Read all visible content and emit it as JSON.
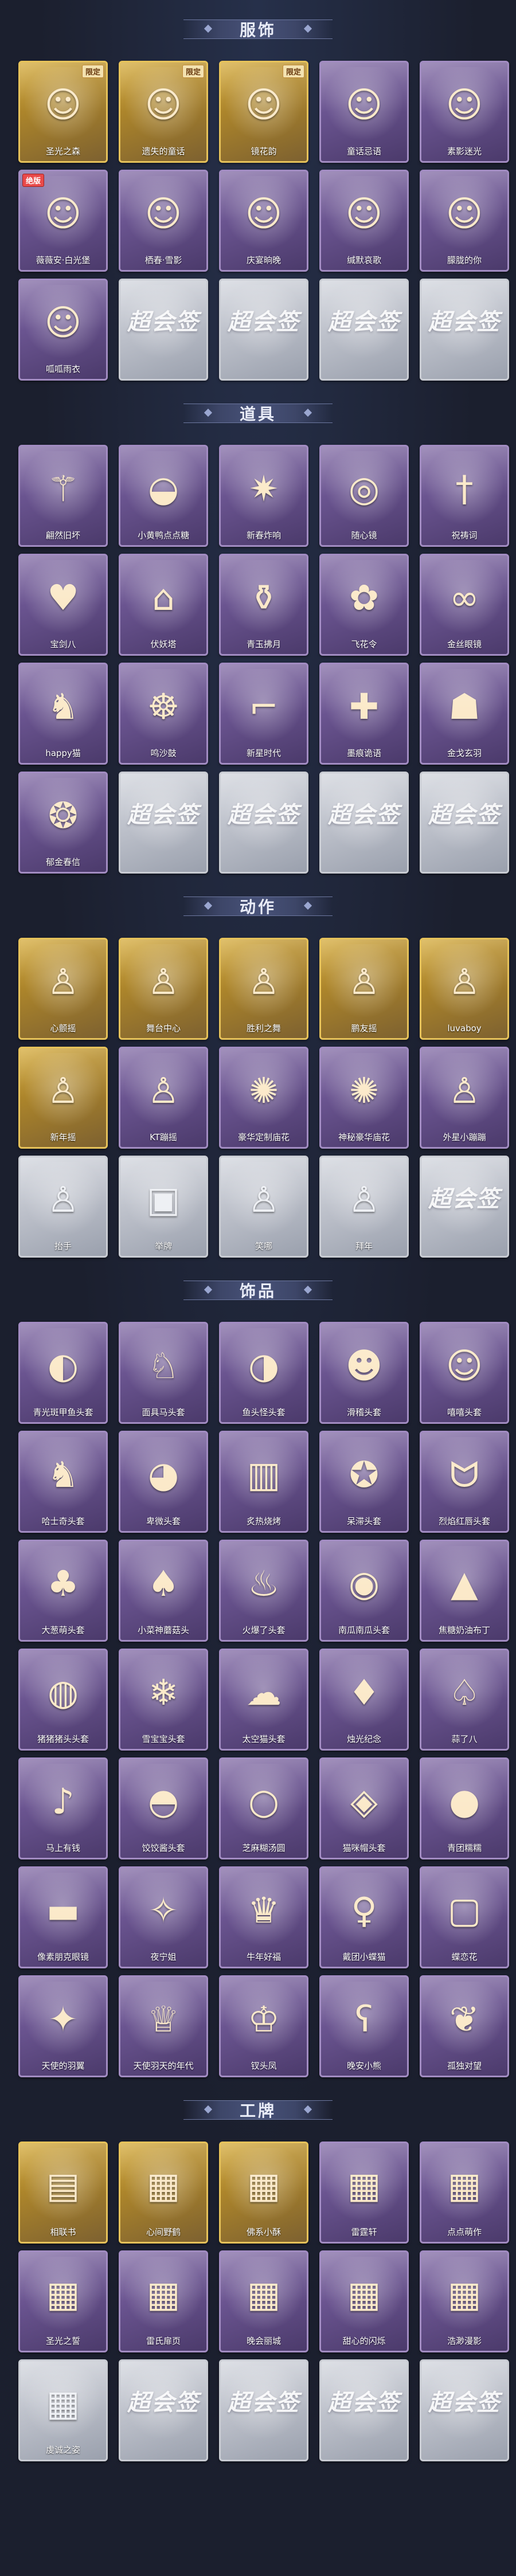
{
  "sections": [
    {
      "title": "服饰",
      "items": [
        {
          "label": "圣光之森",
          "rarity": "gold",
          "badge": "限定",
          "icon": "portrait-icon"
        },
        {
          "label": "遗失的童话",
          "rarity": "gold",
          "badge": "限定",
          "icon": "portrait-icon"
        },
        {
          "label": "镜花韵",
          "rarity": "gold",
          "badge": "限定",
          "icon": "portrait-icon"
        },
        {
          "label": "童话忌语",
          "rarity": "purple",
          "badge": "",
          "icon": "portrait-icon"
        },
        {
          "label": "素影迷光",
          "rarity": "purple",
          "badge": "",
          "icon": "portrait-icon"
        },
        {
          "label": "薇薇安·白光堡",
          "rarity": "purple",
          "badge": "绝版",
          "icon": "portrait-icon"
        },
        {
          "label": "栖春·雪影",
          "rarity": "purple",
          "badge": "",
          "icon": "portrait-icon"
        },
        {
          "label": "庆宴晌晚",
          "rarity": "purple",
          "badge": "",
          "icon": "portrait-icon"
        },
        {
          "label": "缄默哀歌",
          "rarity": "purple",
          "badge": "",
          "icon": "portrait-icon"
        },
        {
          "label": "朦胧的你",
          "rarity": "purple",
          "badge": "",
          "icon": "portrait-icon"
        },
        {
          "label": "呱呱雨衣",
          "rarity": "purple",
          "badge": "",
          "icon": "portrait-icon"
        },
        {
          "label": "",
          "rarity": "grey",
          "badge": "",
          "icon": "placeholder"
        },
        {
          "label": "",
          "rarity": "grey",
          "badge": "",
          "icon": "placeholder"
        },
        {
          "label": "",
          "rarity": "grey",
          "badge": "",
          "icon": "placeholder"
        },
        {
          "label": "",
          "rarity": "grey",
          "badge": "",
          "icon": "placeholder"
        }
      ]
    },
    {
      "title": "道具",
      "items": [
        {
          "label": "翩然旧坏",
          "rarity": "purple",
          "badge": "",
          "icon": "wand-icon"
        },
        {
          "label": "小黄鸭点点糖",
          "rarity": "purple",
          "badge": "",
          "icon": "duck-icon"
        },
        {
          "label": "新春炸响",
          "rarity": "purple",
          "badge": "",
          "icon": "firecracker-icon"
        },
        {
          "label": "随心镜",
          "rarity": "purple",
          "badge": "",
          "icon": "mirror-icon"
        },
        {
          "label": "祝祷词",
          "rarity": "purple",
          "badge": "",
          "icon": "sword-icon"
        },
        {
          "label": "宝剑八",
          "rarity": "purple",
          "badge": "",
          "icon": "heart-icon"
        },
        {
          "label": "伏妖塔",
          "rarity": "purple",
          "badge": "",
          "icon": "tower-icon"
        },
        {
          "label": "青玉拂月",
          "rarity": "purple",
          "badge": "",
          "icon": "bottle-icon"
        },
        {
          "label": "飞花令",
          "rarity": "purple",
          "badge": "",
          "icon": "flower-icon"
        },
        {
          "label": "金丝眼镜",
          "rarity": "purple",
          "badge": "",
          "icon": "glasses-icon"
        },
        {
          "label": "happy猫",
          "rarity": "purple",
          "badge": "",
          "icon": "cat-icon"
        },
        {
          "label": "鸣沙鼓",
          "rarity": "purple",
          "badge": "",
          "icon": "drum-icon"
        },
        {
          "label": "新星时代",
          "rarity": "purple",
          "badge": "",
          "icon": "gun-icon"
        },
        {
          "label": "墨痕诡语",
          "rarity": "purple",
          "badge": "",
          "icon": "medkit-icon"
        },
        {
          "label": "金戈玄羽",
          "rarity": "purple",
          "badge": "",
          "icon": "mask-icon"
        },
        {
          "label": "郁金春信",
          "rarity": "purple",
          "badge": "",
          "icon": "fan-icon"
        },
        {
          "label": "",
          "rarity": "grey",
          "badge": "",
          "icon": "placeholder"
        },
        {
          "label": "",
          "rarity": "grey",
          "badge": "",
          "icon": "placeholder"
        },
        {
          "label": "",
          "rarity": "grey",
          "badge": "",
          "icon": "placeholder"
        },
        {
          "label": "",
          "rarity": "grey",
          "badge": "",
          "icon": "placeholder"
        }
      ]
    },
    {
      "title": "动作",
      "items": [
        {
          "label": "心颤摇",
          "rarity": "gold",
          "badge": "",
          "icon": "pose-icon"
        },
        {
          "label": "舞台中心",
          "rarity": "gold",
          "badge": "",
          "icon": "pose-icon"
        },
        {
          "label": "胜利之舞",
          "rarity": "gold",
          "badge": "",
          "icon": "pose-icon"
        },
        {
          "label": "鹏友摇",
          "rarity": "gold",
          "badge": "",
          "icon": "pose-icon"
        },
        {
          "label": "luvaboy",
          "rarity": "gold",
          "badge": "",
          "icon": "pose-icon"
        },
        {
          "label": "新年摇",
          "rarity": "gold",
          "badge": "",
          "icon": "pose-icon"
        },
        {
          "label": "KT蹦摇",
          "rarity": "purple",
          "badge": "",
          "icon": "pose-icon"
        },
        {
          "label": "豪华定制庙花",
          "rarity": "purple",
          "badge": "",
          "icon": "firework-icon"
        },
        {
          "label": "神秘豪华庙花",
          "rarity": "purple",
          "badge": "",
          "icon": "firework-icon"
        },
        {
          "label": "外星小蹦蹦",
          "rarity": "purple",
          "badge": "",
          "icon": "pose-icon"
        },
        {
          "label": "抬手",
          "rarity": "grey",
          "badge": "",
          "icon": "pose-icon"
        },
        {
          "label": "举牌",
          "rarity": "grey",
          "badge": "",
          "icon": "sign-icon"
        },
        {
          "label": "笑哪",
          "rarity": "grey",
          "badge": "",
          "icon": "pose-icon"
        },
        {
          "label": "拜年",
          "rarity": "grey",
          "badge": "",
          "icon": "pose-icon"
        },
        {
          "label": "",
          "rarity": "grey",
          "badge": "",
          "icon": "placeholder"
        }
      ]
    },
    {
      "title": "饰品",
      "items": [
        {
          "label": "青光斑甲鱼头套",
          "rarity": "purple",
          "badge": "",
          "icon": "fish-icon"
        },
        {
          "label": "面具马头套",
          "rarity": "purple",
          "badge": "",
          "icon": "horse-icon"
        },
        {
          "label": "鱼头怪头套",
          "rarity": "purple",
          "badge": "",
          "icon": "fishhead-icon"
        },
        {
          "label": "滑稽头套",
          "rarity": "purple",
          "badge": "",
          "icon": "smile-icon"
        },
        {
          "label": "嘻嘻头套",
          "rarity": "purple",
          "badge": "",
          "icon": "grin-icon"
        },
        {
          "label": "哈士奇头套",
          "rarity": "purple",
          "badge": "",
          "icon": "dog-icon"
        },
        {
          "label": "卑微头套",
          "rarity": "purple",
          "badge": "",
          "icon": "sad-icon"
        },
        {
          "label": "炙热烧烤",
          "rarity": "purple",
          "badge": "",
          "icon": "toast-icon"
        },
        {
          "label": "呆滞头套",
          "rarity": "purple",
          "badge": "",
          "icon": "dizzy-icon"
        },
        {
          "label": "烈焰红唇头套",
          "rarity": "purple",
          "badge": "",
          "icon": "pikachu-icon"
        },
        {
          "label": "大葱萌头套",
          "rarity": "purple",
          "badge": "",
          "icon": "onion-icon"
        },
        {
          "label": "小菜神蘑菇头",
          "rarity": "purple",
          "badge": "",
          "icon": "mushroom-icon"
        },
        {
          "label": "火爆了头套",
          "rarity": "purple",
          "badge": "",
          "icon": "flame-icon"
        },
        {
          "label": "南瓜南瓜头套",
          "rarity": "purple",
          "badge": "",
          "icon": "pumpkin-icon"
        },
        {
          "label": "焦糖奶油布丁",
          "rarity": "purple",
          "badge": "",
          "icon": "pudding-icon"
        },
        {
          "label": "猪猪猪头头套",
          "rarity": "purple",
          "badge": "",
          "icon": "pig-icon"
        },
        {
          "label": "雪宝宝头套",
          "rarity": "purple",
          "badge": "",
          "icon": "snow-icon"
        },
        {
          "label": "太空猫头套",
          "rarity": "purple",
          "badge": "",
          "icon": "ghost-icon"
        },
        {
          "label": "烛光纪念",
          "rarity": "purple",
          "badge": "",
          "icon": "candle-icon"
        },
        {
          "label": "蒜了八",
          "rarity": "purple",
          "badge": "",
          "icon": "garlic-icon"
        },
        {
          "label": "马上有钱",
          "rarity": "purple",
          "badge": "",
          "icon": "bird-icon"
        },
        {
          "label": "饺饺酱头套",
          "rarity": "purple",
          "badge": "",
          "icon": "dumpling-icon"
        },
        {
          "label": "芝麻糊汤圆",
          "rarity": "purple",
          "badge": "",
          "icon": "mochi-icon"
        },
        {
          "label": "猫咪帽头套",
          "rarity": "purple",
          "badge": "",
          "icon": "catface-icon"
        },
        {
          "label": "青团糯糯",
          "rarity": "purple",
          "badge": "",
          "icon": "green-icon"
        },
        {
          "label": "像素朋克眼镜",
          "rarity": "purple",
          "badge": "",
          "icon": "shades-icon"
        },
        {
          "label": "夜宁姐",
          "rarity": "purple",
          "badge": "",
          "icon": "crystal-icon"
        },
        {
          "label": "牛年好福",
          "rarity": "purple",
          "badge": "",
          "icon": "cake-icon"
        },
        {
          "label": "戴团小蝶猫",
          "rarity": "purple",
          "badge": "",
          "icon": "doll-icon"
        },
        {
          "label": "蝶恋花",
          "rarity": "purple",
          "badge": "",
          "icon": "frame-icon"
        },
        {
          "label": "天使的羽翼",
          "rarity": "purple",
          "badge": "",
          "icon": "angel-icon"
        },
        {
          "label": "天使羽天的年代",
          "rarity": "purple",
          "badge": "",
          "icon": "lady-icon"
        },
        {
          "label": "钗头凤",
          "rarity": "purple",
          "badge": "",
          "icon": "crown-icon"
        },
        {
          "label": "晚安小熊",
          "rarity": "purple",
          "badge": "",
          "icon": "bear-icon"
        },
        {
          "label": "孤独对望",
          "rarity": "purple",
          "badge": "",
          "icon": "charm-icon"
        }
      ]
    },
    {
      "title": "工牌",
      "items": [
        {
          "label": "相联书",
          "rarity": "gold",
          "badge": "",
          "icon": "book-icon"
        },
        {
          "label": "心间野鹤",
          "rarity": "gold",
          "badge": "",
          "icon": "card-icon"
        },
        {
          "label": "佛系小酥",
          "rarity": "gold",
          "badge": "",
          "icon": "card-icon"
        },
        {
          "label": "雷霆轩",
          "rarity": "purple",
          "badge": "",
          "icon": "card-icon"
        },
        {
          "label": "点点萌作",
          "rarity": "purple",
          "badge": "",
          "icon": "card-icon"
        },
        {
          "label": "圣光之誓",
          "rarity": "purple",
          "badge": "",
          "icon": "card-icon"
        },
        {
          "label": "雷氏扉页",
          "rarity": "purple",
          "badge": "",
          "icon": "card-icon"
        },
        {
          "label": "晚会丽城",
          "rarity": "purple",
          "badge": "",
          "icon": "card-icon"
        },
        {
          "label": "甜心的闪烁",
          "rarity": "purple",
          "badge": "",
          "icon": "card-icon"
        },
        {
          "label": "浩渺漫影",
          "rarity": "purple",
          "badge": "",
          "icon": "card-icon"
        },
        {
          "label": "虔诚之姿",
          "rarity": "grey",
          "badge": "",
          "icon": "card-icon"
        },
        {
          "label": "",
          "rarity": "grey",
          "badge": "",
          "icon": "placeholder"
        },
        {
          "label": "",
          "rarity": "grey",
          "badge": "",
          "icon": "placeholder"
        },
        {
          "label": "",
          "rarity": "grey",
          "badge": "",
          "icon": "placeholder"
        },
        {
          "label": "",
          "rarity": "grey",
          "badge": "",
          "icon": "placeholder"
        }
      ]
    }
  ],
  "placeholder_text": "超会签",
  "colors": {
    "gold": "#d9b24a",
    "purple": "#7b659e",
    "grey": "#c5c9d1",
    "background": "#1b1f2e"
  }
}
